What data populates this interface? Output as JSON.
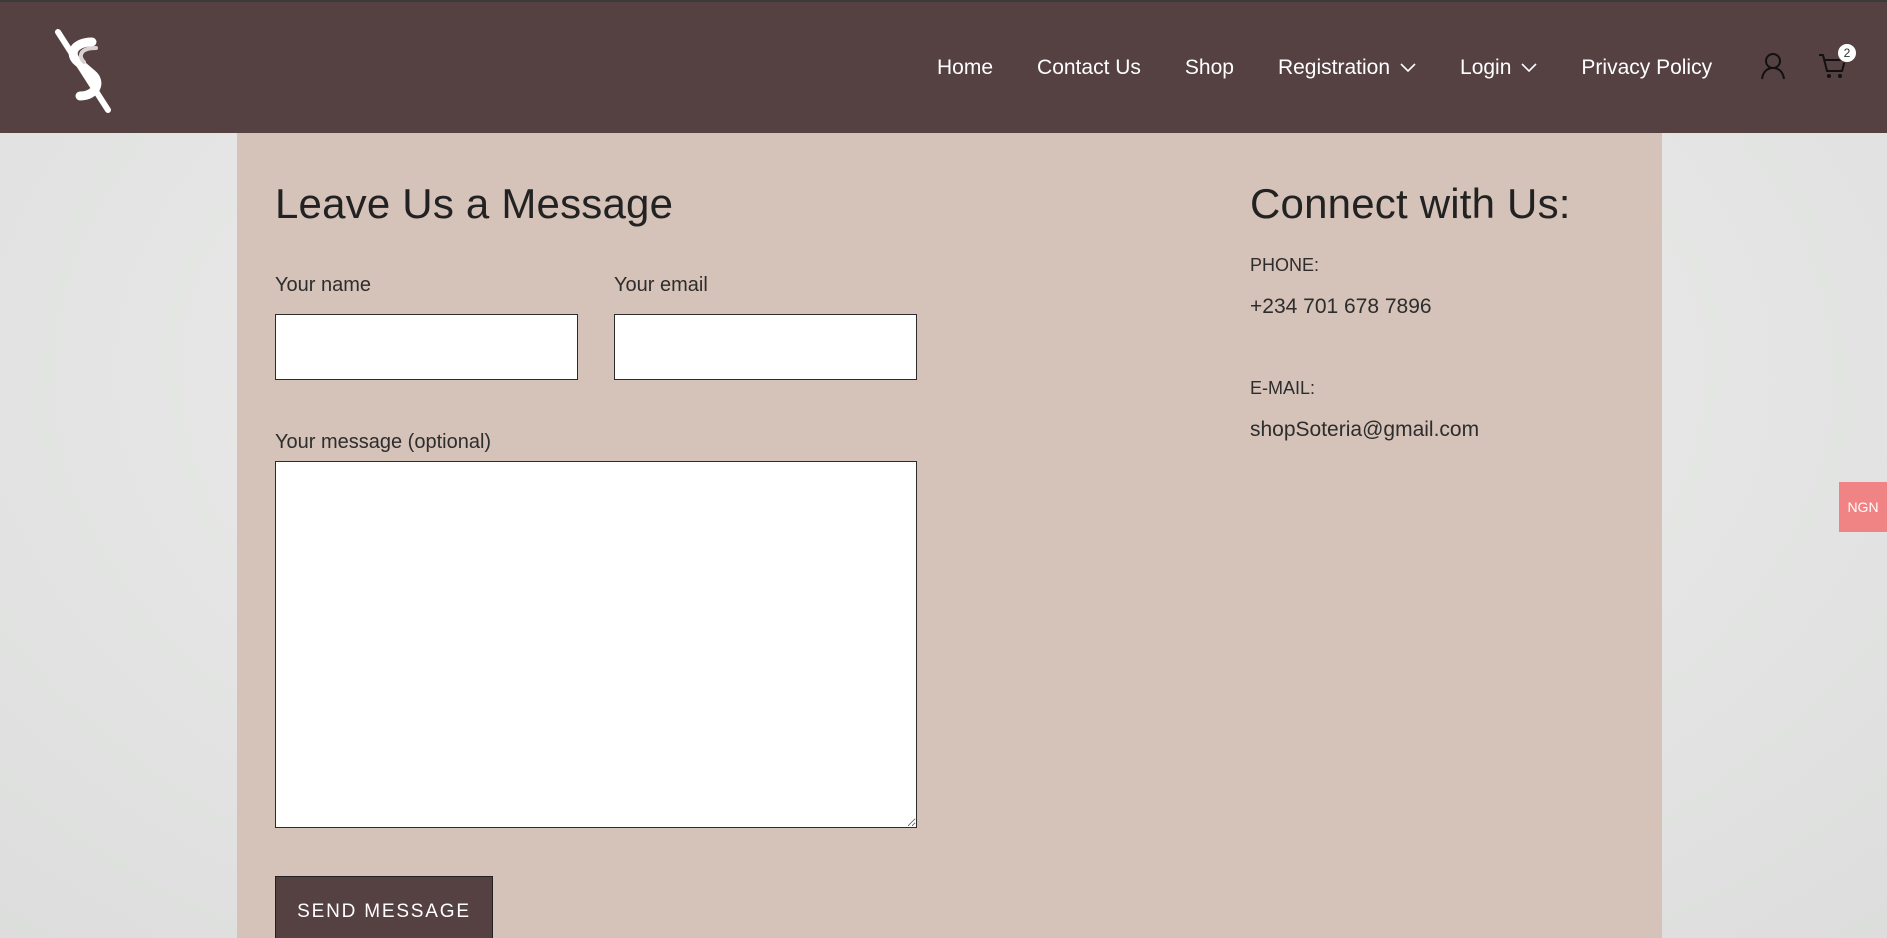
{
  "nav": {
    "items": [
      {
        "label": "Home",
        "has_dropdown": false
      },
      {
        "label": "Contact Us",
        "has_dropdown": false
      },
      {
        "label": "Shop",
        "has_dropdown": false
      },
      {
        "label": "Registration",
        "has_dropdown": true
      },
      {
        "label": "Login",
        "has_dropdown": true
      },
      {
        "label": "Privacy Policy",
        "has_dropdown": false
      }
    ],
    "account_icon": "user-icon",
    "cart_icon": "cart-icon",
    "cart_count": "2"
  },
  "message_form": {
    "title": "Leave Us a Message",
    "name_label": "Your name",
    "name_value": "",
    "email_label": "Your email",
    "email_value": "",
    "message_label": "Your message (optional)",
    "message_value": "",
    "submit_label": "SEND MESSAGE"
  },
  "connect": {
    "title": "Connect with Us:",
    "phone_label": "PHONE:",
    "phone_value": "+234 701 678 7896",
    "email_label": "E-MAIL:",
    "email_value": "shopSoteria@gmail.com"
  },
  "currency_switcher": {
    "label": "NGN"
  },
  "colors": {
    "header_bg": "#554042",
    "panel_bg": "#d5c2b8",
    "button_bg": "#554042",
    "currency_bg": "#f08383"
  }
}
